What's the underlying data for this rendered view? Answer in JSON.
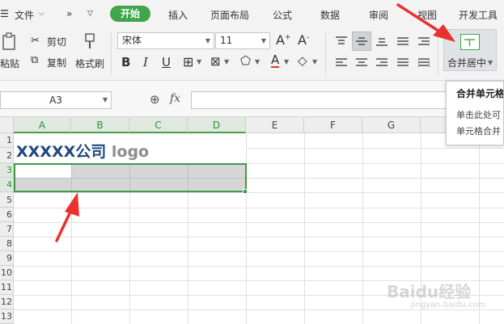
{
  "menubar": {
    "file_label": "文件",
    "more_label": "»",
    "tabs": [
      "开始",
      "插入",
      "页面布局",
      "公式",
      "数据",
      "审阅",
      "视图",
      "开发工具"
    ],
    "active_tab": "开始"
  },
  "ribbon": {
    "paste_label": "粘贴",
    "cut_label": "剪切",
    "copy_label": "复制",
    "format_painter_label": "格式刷",
    "font_name": "宋体",
    "font_size": "11",
    "bold": "B",
    "italic": "I",
    "underline": "U",
    "merge_center_label": "合并居中"
  },
  "formula_bar": {
    "cell_ref": "A3",
    "fx_label": "fx",
    "formula_value": ""
  },
  "tooltip": {
    "title": "合并单元格",
    "line1": "单击此处可",
    "line2": "单元格合并"
  },
  "sheet": {
    "columns": [
      "A",
      "B",
      "C",
      "D",
      "E",
      "F",
      "G"
    ],
    "rows": [
      "1",
      "2",
      "3",
      "4",
      "5",
      "6",
      "7",
      "8",
      "9",
      "10",
      "11",
      "12",
      "13"
    ],
    "title_main": "XXXXX公司",
    "title_logo": "logo",
    "selected_range": "A3:D4"
  },
  "watermark": {
    "brand": "Baidu经验",
    "url": "jingyan.baidu.com"
  },
  "colors": {
    "accent_green": "#3fa64b",
    "title_blue": "#1f497d",
    "annotation_red": "#e8322e"
  }
}
